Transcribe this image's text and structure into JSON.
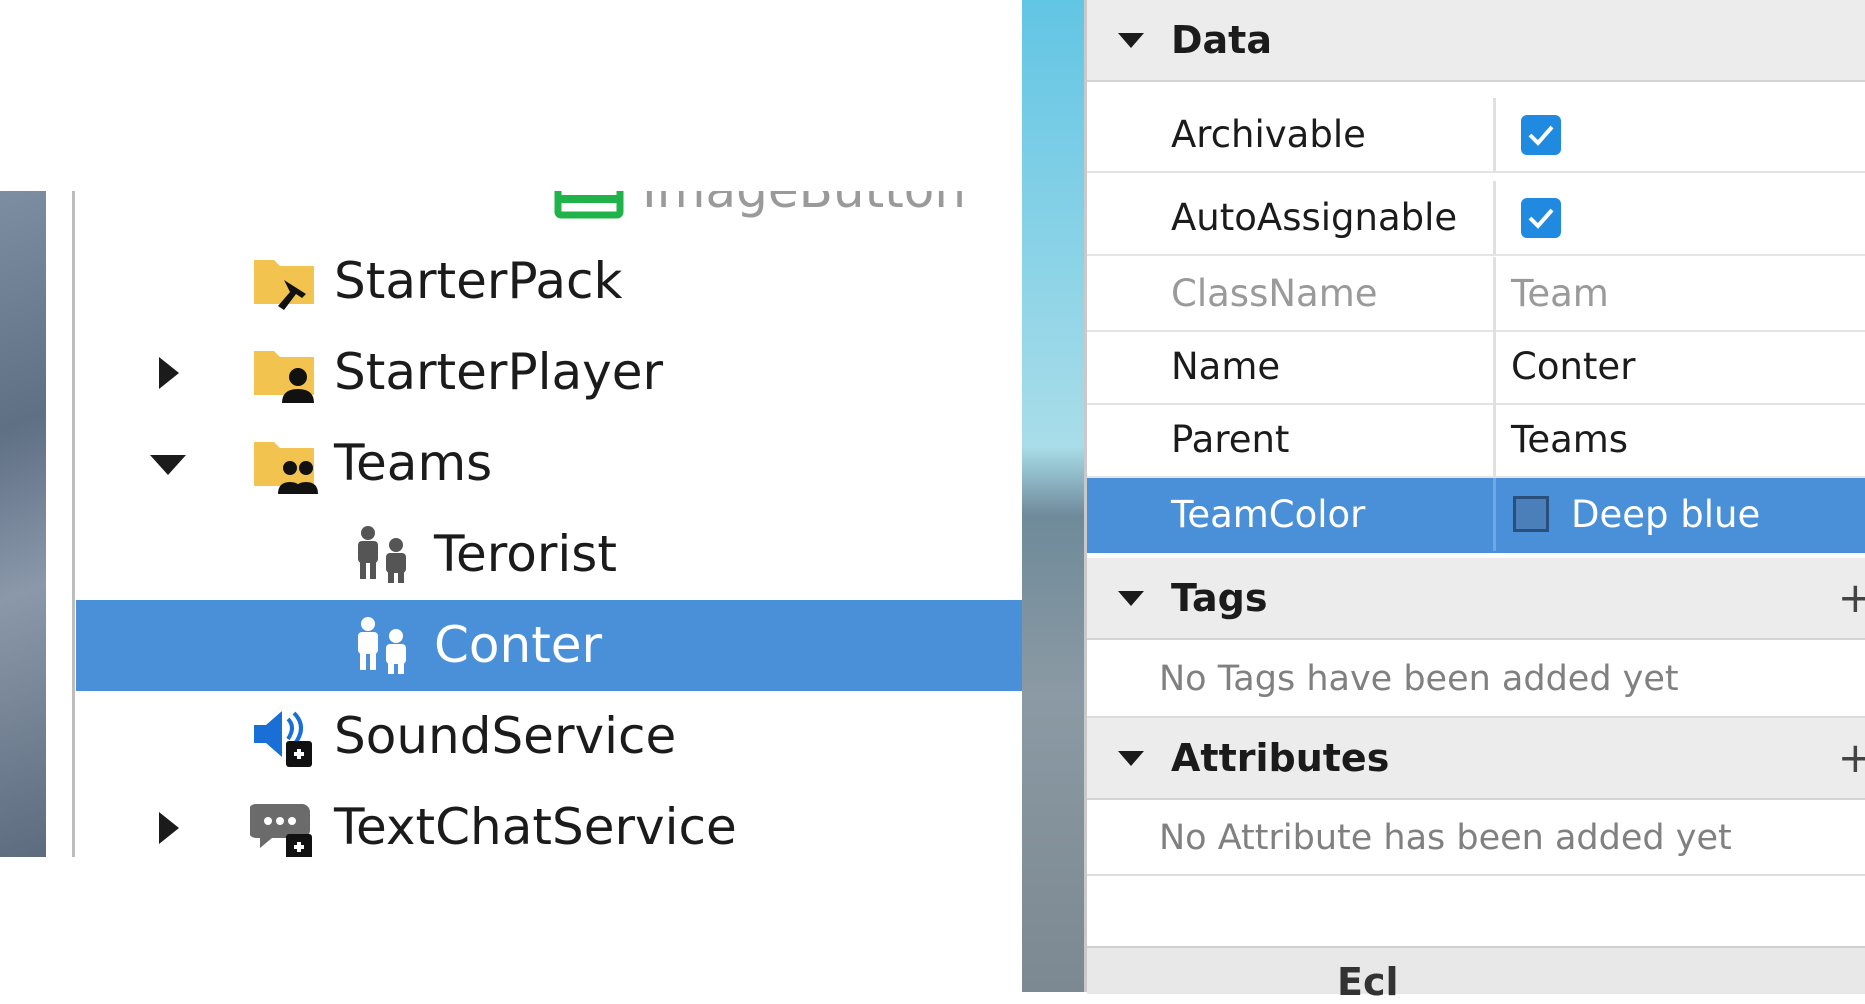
{
  "explorer": {
    "items": [
      {
        "label": "ImageButton",
        "expand": "none",
        "icon": "image-button-icon"
      },
      {
        "label": "StarterPack",
        "expand": "none",
        "icon": "starter-pack-folder-icon"
      },
      {
        "label": "StarterPlayer",
        "expand": "collapsed",
        "icon": "starter-player-folder-icon"
      },
      {
        "label": "Teams",
        "expand": "expanded",
        "icon": "teams-folder-icon"
      },
      {
        "label": "Terorist",
        "expand": "none",
        "icon": "team-icon"
      },
      {
        "label": "Conter",
        "expand": "none",
        "icon": "team-icon",
        "selected": true
      },
      {
        "label": "SoundService",
        "expand": "none",
        "icon": "sound-service-icon"
      },
      {
        "label": "TextChatService",
        "expand": "collapsed",
        "icon": "text-chat-service-icon"
      }
    ]
  },
  "properties": {
    "data_section": {
      "title": "Data"
    },
    "rows": [
      {
        "name": "Archivable",
        "type": "checkbox",
        "checked": true
      },
      {
        "name": "AutoAssignable",
        "type": "checkbox",
        "checked": true
      },
      {
        "name": "ClassName",
        "value": "Team",
        "readonly": true
      },
      {
        "name": "Name",
        "value": "Conter"
      },
      {
        "name": "Parent",
        "value": "Teams"
      },
      {
        "name": "TeamColor",
        "value": "Deep blue",
        "selected": true,
        "swatch_color": "#4a7fb9"
      }
    ],
    "tags_section": {
      "title": "Tags",
      "add_label": "+",
      "empty_text": "No Tags have been added yet"
    },
    "attributes_section": {
      "title": "Attributes",
      "add_label": "+",
      "empty_text": "No Attribute has been added yet"
    },
    "bottom_label": "Ecl"
  },
  "colors": {
    "selection": "#4a90d9",
    "checkbox": "#1f8ae0"
  }
}
